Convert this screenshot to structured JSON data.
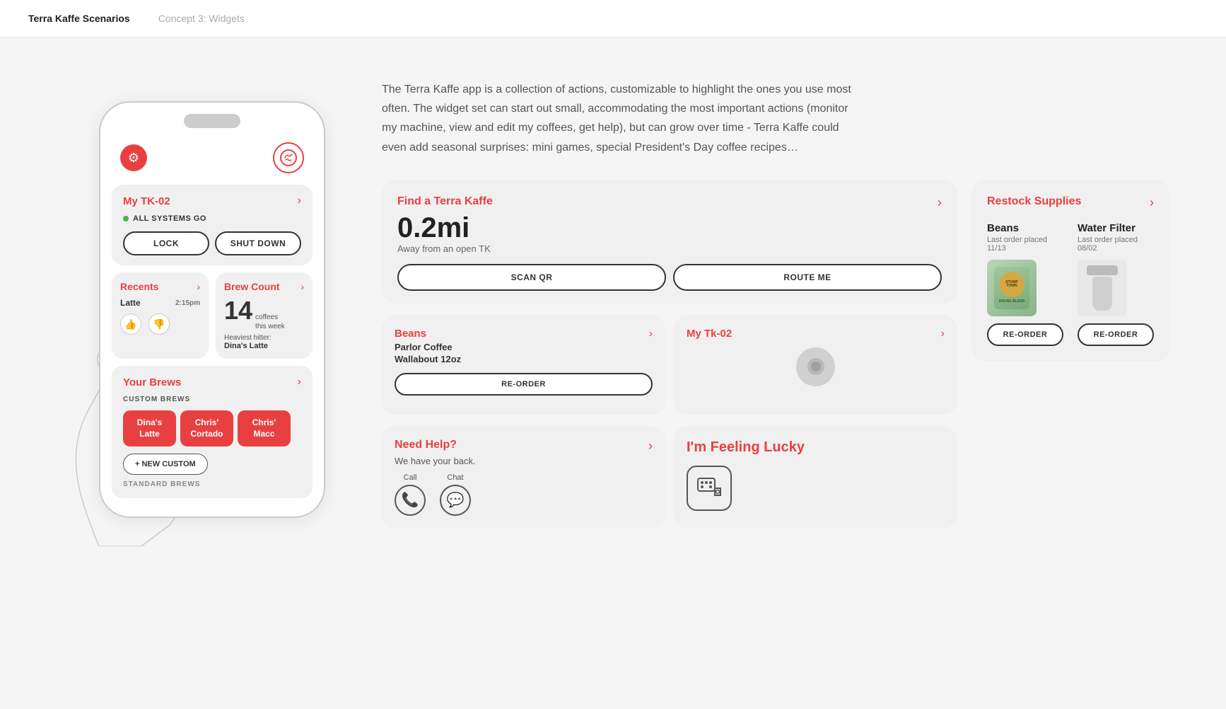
{
  "header": {
    "title": "Terra Kaffe Scenarios",
    "subtitle": "Concept 3: Widgets"
  },
  "description": "The Terra Kaffe app is a collection of actions, customizable to highlight the ones you use most often. The widget set can start out small, accommodating the most important actions (monitor my machine,  view and edit my coffees, get help), but can grow over time - Terra Kaffe could even add seasonal surprises: mini games, special President's Day coffee recipes…",
  "phone": {
    "tk02_title": "My TK-02",
    "status": "ALL SYSTEMS GO",
    "lock_btn": "LOCK",
    "shutdown_btn": "SHUT DOWN",
    "recents_title": "Recents",
    "latte_label": "Latte",
    "latte_time": "2:15pm",
    "brew_count_title": "Brew Count",
    "brew_number": "14",
    "brew_unit": "coffees",
    "brew_period": "this week",
    "heaviest_label": "Heaviest hitter:",
    "heaviest_name": "Dina's Latte",
    "your_brews_title": "Your Brews",
    "custom_brews_label": "CUSTOM BREWS",
    "brew1": "Dina's\nLatte",
    "brew2": "Chris'\nCortado",
    "brew3": "Chris'\nMacc",
    "new_custom_btn": "+ NEW CUSTOM",
    "standard_brews_label": "STANDARD BREWS"
  },
  "find_tk": {
    "title": "Find a Terra Kaffe",
    "arrow": "›",
    "distance": "0.2mi",
    "subtitle": "Away from an open TK",
    "scan_btn": "SCAN QR",
    "route_btn": "ROUTE ME"
  },
  "restock": {
    "title": "Restock Supplies",
    "arrow": "›",
    "beans_title": "Beans",
    "beans_last_order": "Last order placed 11/13",
    "filter_title": "Water Filter",
    "filter_last_order": "Last order placed 08/02",
    "reorder_btn": "RE-ORDER"
  },
  "beans_widget": {
    "title": "Beans",
    "arrow": "›",
    "product": "Parlor Coffee\nWallabout 12oz",
    "reorder_btn": "RE-ORDER"
  },
  "my_tk02_widget": {
    "title": "My Tk-02",
    "arrow": "›"
  },
  "help": {
    "title": "Need Help?",
    "arrow": "›",
    "subtitle": "We have your back.",
    "call_label": "Call",
    "chat_label": "Chat"
  },
  "lucky": {
    "title": "I'm Feeling Lucky"
  },
  "colors": {
    "red": "#e84040",
    "bg": "#f0f0f0",
    "white": "#ffffff"
  }
}
